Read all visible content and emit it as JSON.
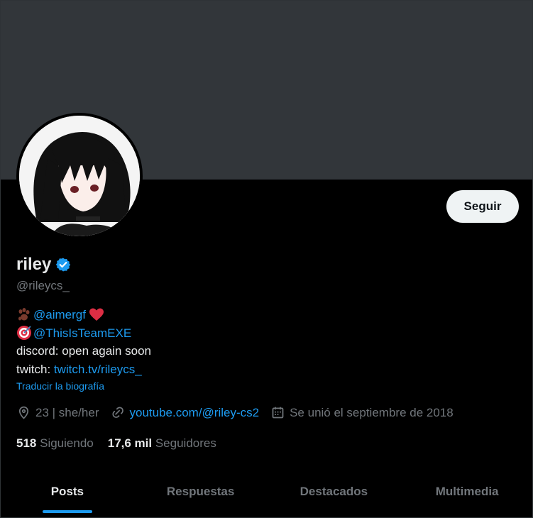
{
  "profile": {
    "name": "riley",
    "handle": "@rileycs_",
    "follow_label": "Seguir"
  },
  "bio": {
    "line1_link": "@aimergf",
    "line2_link": "@ThisIsTeamEXE",
    "line3": "discord: open again soon",
    "line4_prefix": "twitch: ",
    "line4_link": "twitch.tv/rileycs_",
    "translate": "Traducir la biografía"
  },
  "meta": {
    "location": "23 | she/her",
    "website": "youtube.com/@riley-cs2",
    "joined": "Se unió el septiembre de 2018"
  },
  "counts": {
    "following_num": "518",
    "following_label": "Siguiendo",
    "followers_num": "17,6 mil",
    "followers_label": "Seguidores"
  },
  "tabs": [
    {
      "label": "Posts",
      "active": true
    },
    {
      "label": "Respuestas",
      "active": false
    },
    {
      "label": "Destacados",
      "active": false
    },
    {
      "label": "Multimedia",
      "active": false
    }
  ],
  "colors": {
    "accent": "#1d9bf0",
    "banner": "#32363a",
    "muted": "#71767b"
  },
  "icons": [
    "verified-badge-icon",
    "paw-emoji-icon",
    "heart-emoji-icon",
    "target-emoji-icon",
    "location-icon",
    "link-icon",
    "calendar-icon"
  ]
}
